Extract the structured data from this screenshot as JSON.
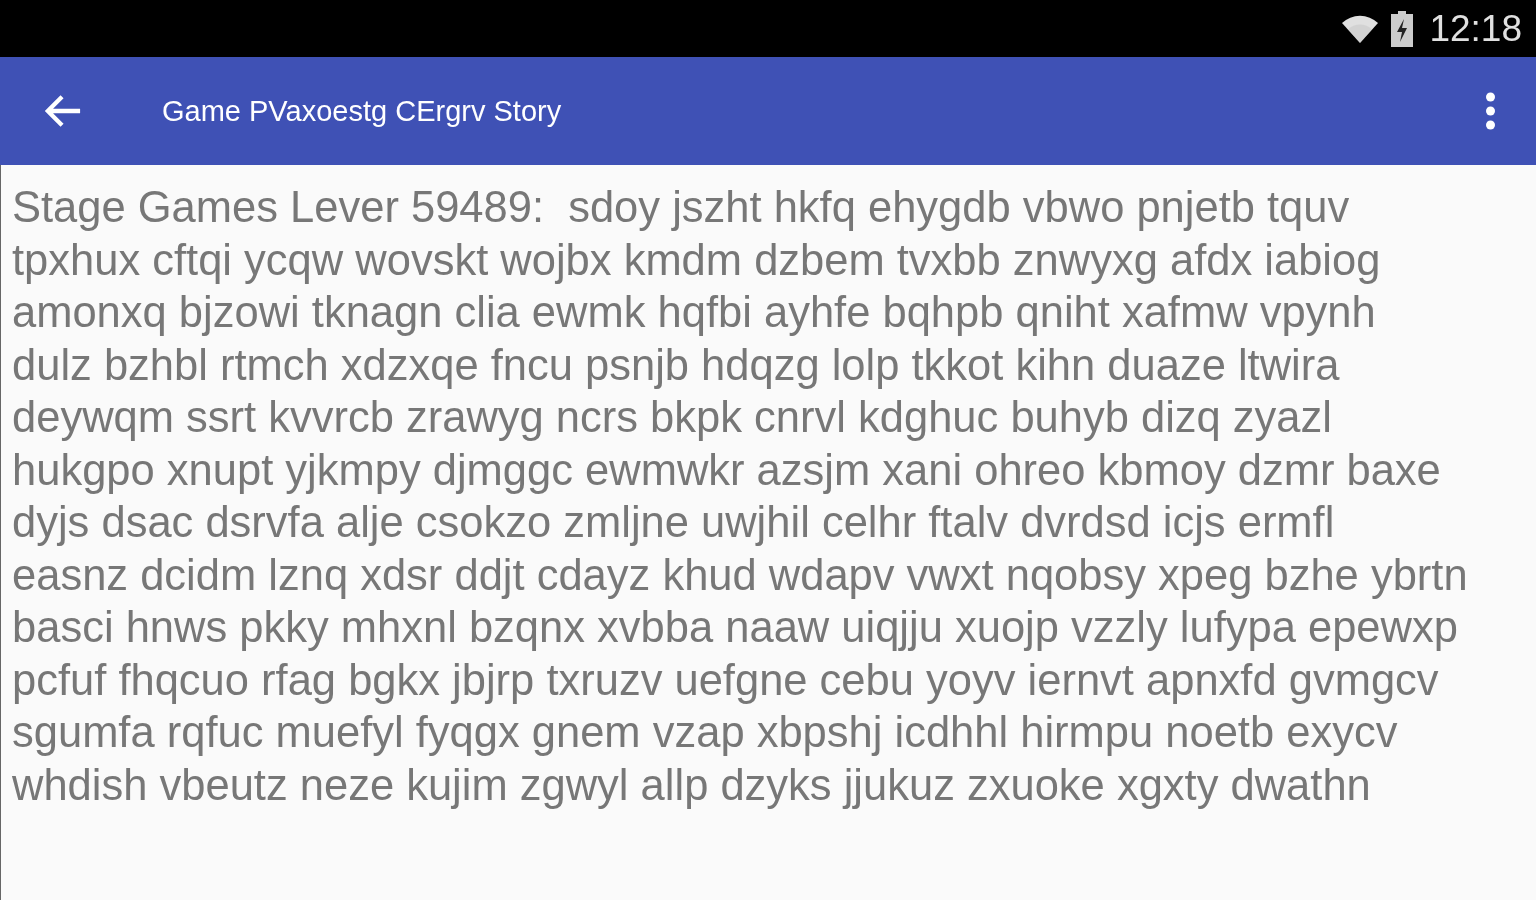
{
  "status_bar": {
    "time": "12:18"
  },
  "app_bar": {
    "title": "Game PVaxoestg CErgrv Story"
  },
  "story": {
    "lines": [
      "Stage Games Lever 59489:  sdoy jszht hkfq ehygdb vbwo pnjetb tquv",
      "tpxhux cftqi ycqw wovskt wojbx kmdm dzbem tvxbb znwyxg afdx iabiog",
      "amonxq bjzowi tknagn clia ewmk hqfbi ayhfe bqhpb qniht xafmw vpynh",
      "dulz bzhbl rtmch xdzxqe fncu psnjb hdqzg lolp tkkot kihn duaze ltwira",
      "deywqm ssrt kvvrcb zrawyg ncrs bkpk cnrvl kdghuc buhyb dizq zyazl",
      "hukgpo xnupt yjkmpy djmggc ewmwkr azsjm xani ohreo kbmoy dzmr baxe",
      "dyjs dsac dsrvfa alje csokzo zmljne uwjhil celhr ftalv dvrdsd icjs ermfl",
      "easnz dcidm lznq xdsr ddjt cdayz khud wdapv vwxt nqobsy xpeg bzhe ybrtn",
      "basci hnws pkky mhxnl bzqnx xvbba naaw uiqjju xuojp vzzly lufypa epewxp",
      "pcfuf fhqcuo rfag bgkx jbjrp txruzv uefgne cebu yoyv iernvt apnxfd gvmgcv",
      "sgumfa rqfuc muefyl fyqgx gnem vzap xbpshj icdhhl hirmpu noetb exycv",
      "whdish vbeutz neze kujim zgwyl allp dzyks jjukuz zxuoke xgxty dwathn"
    ]
  }
}
